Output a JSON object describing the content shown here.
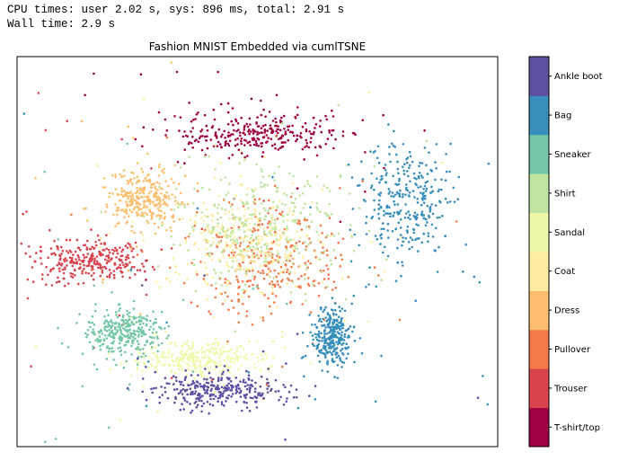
{
  "output": {
    "cpu_times": "CPU times: user 2.02 s, sys: 896 ms, total: 2.91 s",
    "wall_time": "Wall time: 2.9 s"
  },
  "chart_data": {
    "type": "scatter",
    "title": "Fashion MNIST Embedded via cumlTSNE",
    "axes_visible": false,
    "grid": false,
    "xlim": [
      -60,
      60
    ],
    "ylim": [
      -50,
      50
    ],
    "colormap": "Spectral",
    "colorbar": {
      "position": "right",
      "labels": [
        "T-shirt/top",
        "Trouser",
        "Pullover",
        "Dress",
        "Coat",
        "Sandal",
        "Shirt",
        "Sneaker",
        "Bag",
        "Ankle boot"
      ],
      "colors": [
        "#9e0142",
        "#d8434e",
        "#f67a49",
        "#fdbf6f",
        "#feeda1",
        "#f1f9a9",
        "#bfe5a0",
        "#74c7a5",
        "#378ebb",
        "#5e4fa2"
      ]
    },
    "clusters": [
      {
        "label": "T-shirt/top",
        "center": [
          -0.3,
          30
        ],
        "spread": [
          18,
          4.6
        ]
      },
      {
        "label": "Trouser",
        "center": [
          -41.8,
          -2.3
        ],
        "spread": [
          12,
          5
        ]
      },
      {
        "label": "Pullover",
        "center": [
          3,
          -2
        ],
        "spread": [
          15,
          12
        ]
      },
      {
        "label": "Dress",
        "center": [
          -28.4,
          13.8
        ],
        "spread": [
          8,
          7
        ]
      },
      {
        "label": "Coat",
        "center": [
          -3.7,
          2.3
        ],
        "spread": [
          15,
          10
        ]
      },
      {
        "label": "Sandal",
        "center": [
          -15,
          -27.6
        ],
        "spread": [
          14,
          4
        ]
      },
      {
        "label": "Shirt",
        "center": [
          0.8,
          7
        ],
        "spread": [
          17,
          12
        ]
      },
      {
        "label": "Sneaker",
        "center": [
          -32.9,
          -20.7
        ],
        "spread": [
          8,
          5
        ]
      },
      {
        "label": "Bag",
        "center": [
          37.8,
          12.7
        ],
        "spread": [
          10,
          12
        ]
      },
      {
        "label": "Bag",
        "center": [
          18.7,
          -21.9
        ],
        "spread": [
          4,
          6
        ]
      },
      {
        "label": "Ankle boot",
        "center": [
          -9.3,
          -35.7
        ],
        "spread": [
          14,
          4
        ]
      }
    ]
  }
}
